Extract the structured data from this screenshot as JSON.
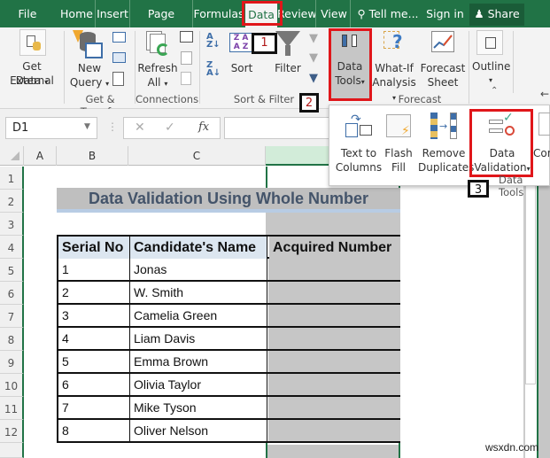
{
  "tabs": {
    "file": "File",
    "home": "Home",
    "insert": "Insert",
    "page_layout": "Page Layou",
    "formulas": "Formulas",
    "data": "Data",
    "review": "Review",
    "view": "View",
    "tell_me": "Tell me...",
    "sign_in": "Sign in",
    "share": "Share"
  },
  "ribbon": {
    "get_external_data": [
      "Get External",
      "Data"
    ],
    "new_query": [
      "New",
      "Query"
    ],
    "refresh_all": [
      "Refresh",
      "All"
    ],
    "sort": "Sort",
    "filter": "Filter",
    "data_tools": [
      "Data",
      "Tools"
    ],
    "what_if": [
      "What-If",
      "Analysis"
    ],
    "forecast_sheet": [
      "Forecast",
      "Sheet"
    ],
    "outline": "Outline",
    "groups": {
      "get_transform": "Get & Transf...",
      "connections": "Connections",
      "sort_filter": "Sort & Filter",
      "forecast": "Forecast"
    }
  },
  "data_tools_panel": {
    "text_to_columns": [
      "Text to",
      "Columns"
    ],
    "flash_fill": [
      "Flash",
      "Fill"
    ],
    "remove_duplicates": [
      "Remove",
      "Duplicates"
    ],
    "data_validation": [
      "Data",
      "Validation"
    ],
    "consolidate_partial": "Cons",
    "group_label": "Data Tools"
  },
  "annotations": [
    "1",
    "2",
    "3"
  ],
  "formula_bar": {
    "name_box": "D1",
    "cancel": "✕",
    "enter": "✓",
    "fx": "fx",
    "formula": ""
  },
  "columns": [
    "A",
    "B",
    "C"
  ],
  "rows": [
    "1",
    "2",
    "3",
    "4",
    "5",
    "6",
    "7",
    "8",
    "9",
    "10",
    "11",
    "12"
  ],
  "sheet": {
    "title": "Data Validation Using Whole Number",
    "headers": [
      "Serial No",
      "Candidate's Name",
      "Acquired Number"
    ],
    "records": [
      {
        "serial": "1",
        "name": "Jonas",
        "acquired": ""
      },
      {
        "serial": "2",
        "name": "W. Smith",
        "acquired": ""
      },
      {
        "serial": "3",
        "name": "Camelia Green",
        "acquired": ""
      },
      {
        "serial": "4",
        "name": "Liam Davis",
        "acquired": ""
      },
      {
        "serial": "5",
        "name": "Emma Brown",
        "acquired": ""
      },
      {
        "serial": "6",
        "name": "Olivia Taylor",
        "acquired": ""
      },
      {
        "serial": "7",
        "name": "Mike Tyson",
        "acquired": ""
      },
      {
        "serial": "8",
        "name": "Oliver Nelson",
        "acquired": ""
      }
    ]
  },
  "watermark": "wsxdn.com",
  "colors": {
    "excel_green": "#217346",
    "highlight_red": "#e0161a",
    "header_fill": "#dce6f0",
    "selection_fill": "#c6c6c6"
  }
}
